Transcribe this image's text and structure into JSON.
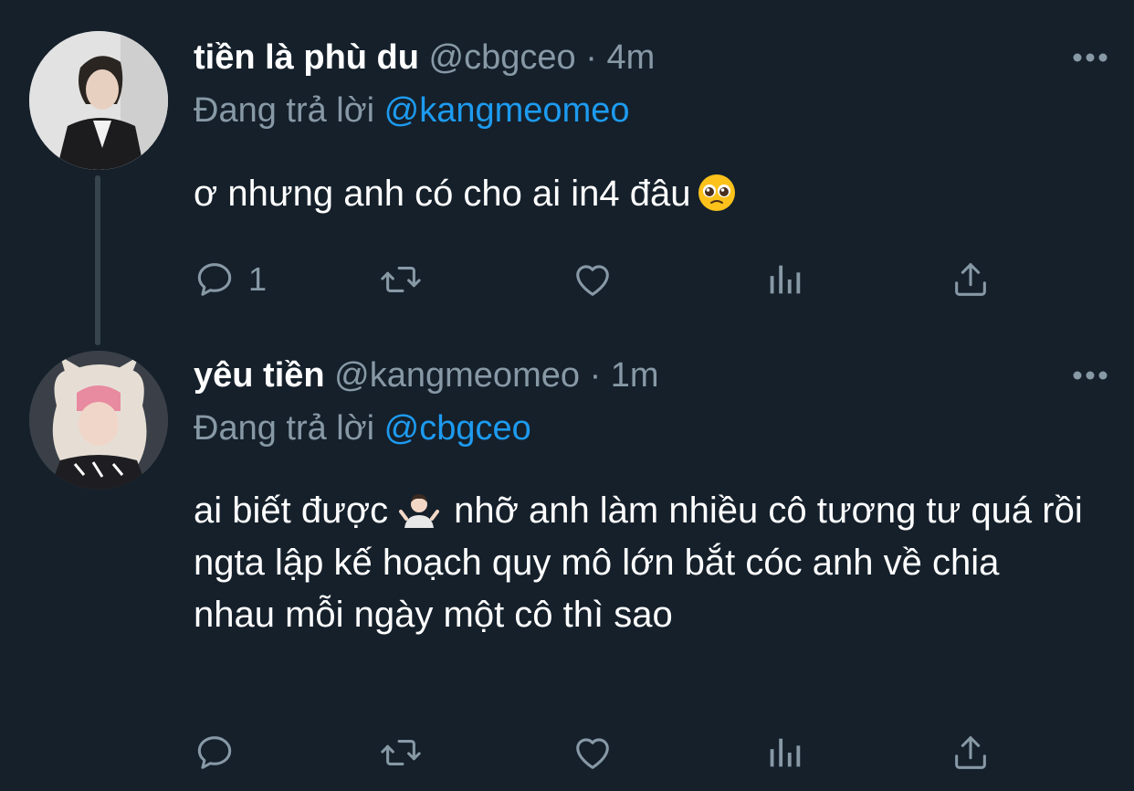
{
  "tweets": [
    {
      "display_name": "tiền là phù du",
      "handle": "@cbgceo",
      "separator": "·",
      "time": "4m",
      "replying_prefix": "Đang trả lời",
      "replying_to": "@kangmeomeo",
      "text": "ơ nhưng anh có cho ai in4 đâu",
      "emoji": "pleading-face-emoji",
      "reply_count": "1",
      "avatar": "user-avatar-photo"
    },
    {
      "display_name": "yêu tiền",
      "handle": "@kangmeomeo",
      "separator": "·",
      "time": "1m",
      "replying_prefix": "Đang trả lời",
      "replying_to": "@cbgceo",
      "text_before_emoji": "ai biết được",
      "emoji": "person-shrugging-emoji",
      "text_after_emoji": "nhỡ anh làm nhiều cô tương tư quá rồi ngta lập kế hoạch quy mô lớn bắt cóc anh về chia nhau mỗi ngày một cô thì sao",
      "reply_count": "",
      "avatar": "user-avatar-photo"
    }
  ],
  "icons": {
    "reply": "reply-icon",
    "retweet": "retweet-icon",
    "like": "like-icon",
    "views": "views-icon",
    "share": "share-icon",
    "more": "more-icon"
  },
  "colors": {
    "background": "#15202b",
    "text": "#ffffff",
    "secondary": "#8899a6",
    "link": "#1d9bf0",
    "thread_line": "#38444d"
  }
}
